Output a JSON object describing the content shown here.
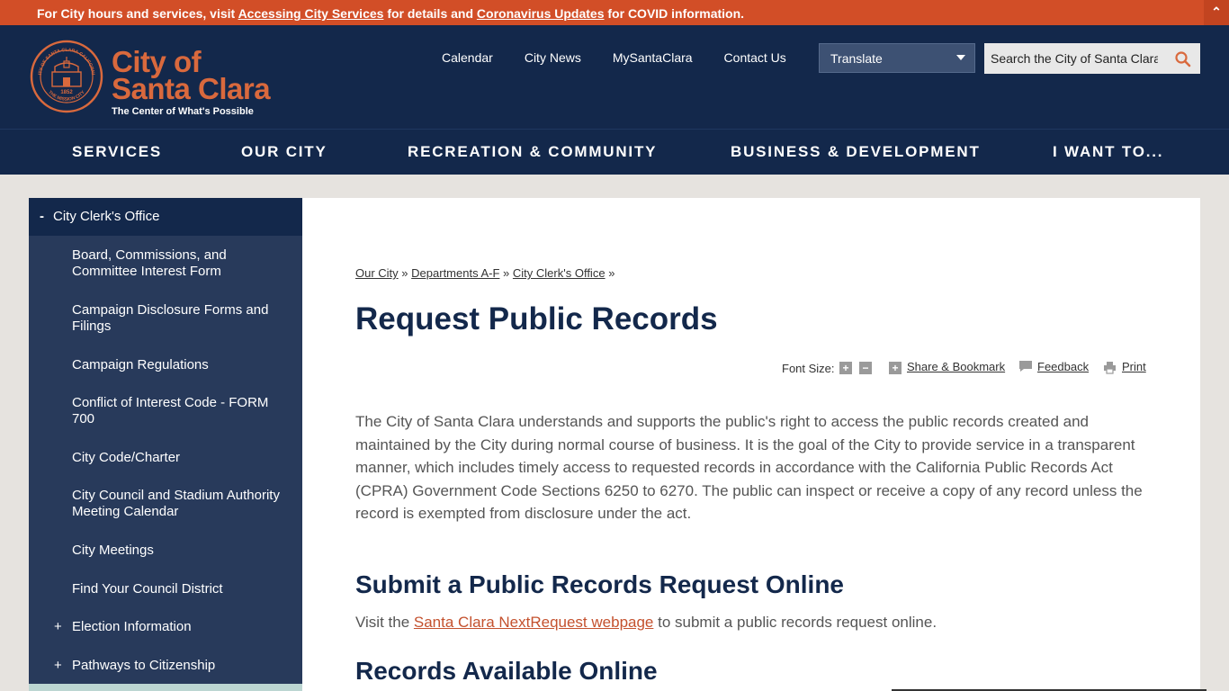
{
  "alert": {
    "prefix": "For City hours and services, visit ",
    "link1": "Accessing City Services",
    "middle": " for details and ",
    "link2": "Coronavirus Updates",
    "suffix": " for COVID information.",
    "toggle": "⌃"
  },
  "logo": {
    "line1": "City of",
    "line2": "Santa Clara",
    "tagline": "The Center of What's Possible",
    "seal_top_text": "CITY OF SANTA CLARA CALIFORNIA",
    "seal_year": "1852",
    "seal_bottom_text": "THE MISSION CITY"
  },
  "utility": {
    "calendar": "Calendar",
    "city_news": "City News",
    "mysantaclara": "MySantaClara",
    "contact": "Contact Us"
  },
  "translate": {
    "label": "Translate"
  },
  "search": {
    "placeholder": "Search the City of Santa Clara"
  },
  "nav": {
    "services": "SERVICES",
    "our_city": "OUR CITY",
    "recreation": "RECREATION & COMMUNITY",
    "business": "BUSINESS & DEVELOPMENT",
    "i_want_to": "I WANT TO..."
  },
  "sidebar": {
    "heading": "City Clerk's Office",
    "heading_symbol": "-",
    "items": [
      "Board, Commissions, and Committee Interest Form",
      "Campaign Disclosure Forms and Filings",
      "Campaign Regulations",
      "Conflict of Interest Code - FORM 700",
      "City Code/Charter",
      "City Council and Stadium Authority Meeting Calendar",
      "City Meetings",
      "Find Your Council District",
      "Election Information",
      "Pathways to Citizenship"
    ],
    "expand_symbol": "+"
  },
  "breadcrumb": {
    "item1": "Our City",
    "item2": "Departments A-F",
    "item3": "City Clerk's Office",
    "sep": "»"
  },
  "page": {
    "title": "Request Public Records",
    "intro": "The City of Santa Clara understands and supports the public's right to access the public records created and maintained by the City during normal course of business. It is the goal of the City to provide service in a transparent manner, which includes timely access to requested records in accordance with the California Public Records Act (CPRA) Government Code Sections 6250 to 6270. The public can inspect or receive a copy of any record unless the record is exempted from disclosure under the act.",
    "h2_submit": "Submit a Public Records Request Online",
    "visit_prefix": "Visit the ",
    "visit_link": "Santa Clara NextRequest webpage",
    "visit_suffix": " to submit a public records request online.",
    "h2_records": "Records Available Online"
  },
  "tools": {
    "font_size_label": "Font Size:",
    "increase": "+",
    "decrease": "−",
    "share_icon": "+",
    "share": "Share & Bookmark",
    "feedback": "Feedback",
    "print": "Print"
  },
  "colors": {
    "alert_bar": "#d24e27",
    "navy": "#13284b",
    "sidebar": "#283a5b",
    "accent_orange": "#d9693d"
  }
}
